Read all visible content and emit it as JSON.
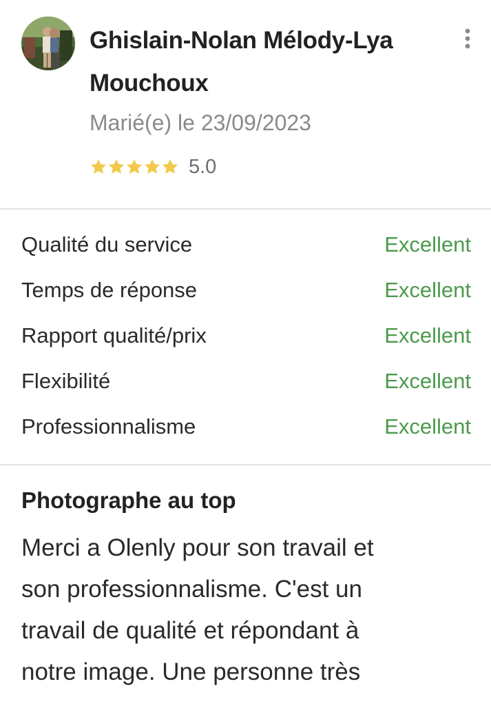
{
  "reviewer": {
    "name_line1": "Ghislain-Nolan Mélody-Lya",
    "name_line2": "Mouchoux",
    "married_date": "Marié(e) le 23/09/2023",
    "rating_value": "5.0",
    "stars": 5,
    "star_color": "#f2c94c"
  },
  "criteria": [
    {
      "label": "Qualité du service",
      "value": "Excellent"
    },
    {
      "label": "Temps de réponse",
      "value": "Excellent"
    },
    {
      "label": "Rapport qualité/prix",
      "value": "Excellent"
    },
    {
      "label": "Flexibilité",
      "value": "Excellent"
    },
    {
      "label": "Professionnalisme",
      "value": "Excellent"
    }
  ],
  "review": {
    "title": "Photographe au top",
    "body_lines": [
      "Merci a Olenly pour son travail et",
      "son professionnalisme. C'est un",
      "travail de qualité et répondant à",
      "notre image. Une personne très"
    ]
  },
  "icons": {
    "more": "more-vertical-icon",
    "star": "star-icon"
  },
  "colors": {
    "excellent": "#4c9a4c",
    "muted": "#8a8a8a"
  }
}
